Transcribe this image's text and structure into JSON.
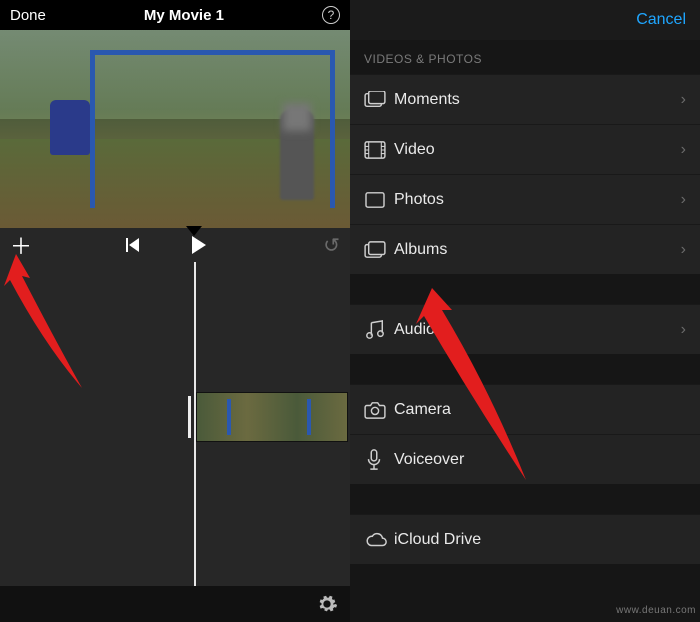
{
  "left": {
    "done": "Done",
    "title": "My Movie 1",
    "help_glyph": "?",
    "add_glyph": "＋",
    "undo_glyph": "↺"
  },
  "right": {
    "cancel": "Cancel",
    "section_label": "VIDEOS & PHOTOS",
    "rows": {
      "moments": "Moments",
      "video": "Video",
      "photos": "Photos",
      "albums": "Albums",
      "audio": "Audio",
      "camera": "Camera",
      "voiceover": "Voiceover",
      "icloud": "iCloud Drive"
    },
    "chevron": "›"
  },
  "watermark": "www.deuan.com"
}
